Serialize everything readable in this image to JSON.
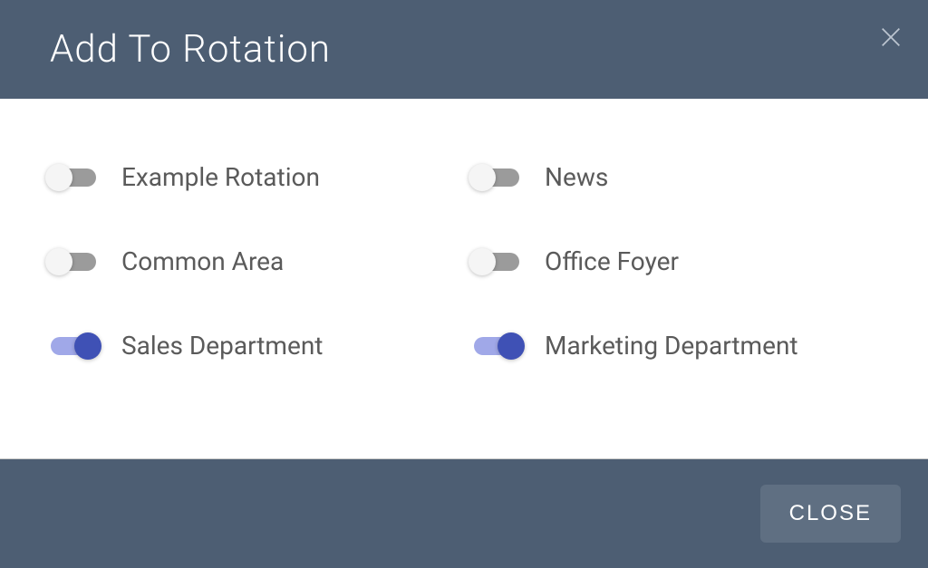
{
  "header": {
    "title": "Add To Rotation"
  },
  "rotations": [
    {
      "label": "Example Rotation",
      "enabled": false
    },
    {
      "label": "News",
      "enabled": false
    },
    {
      "label": "Common Area",
      "enabled": false
    },
    {
      "label": "Office Foyer",
      "enabled": false
    },
    {
      "label": "Sales Department",
      "enabled": true
    },
    {
      "label": "Marketing Department",
      "enabled": true
    }
  ],
  "footer": {
    "close_label": "CLOSE"
  }
}
